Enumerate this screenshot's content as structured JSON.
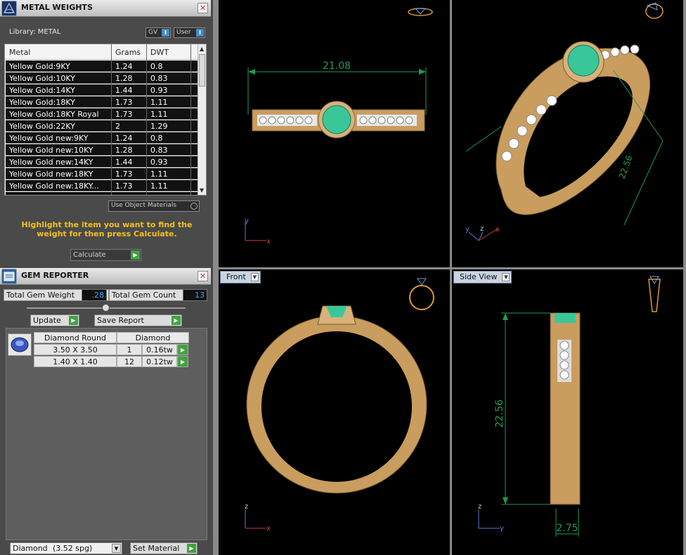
{
  "metal_panel": {
    "title": "METAL WEIGHTS",
    "library_label": "Library: METAL",
    "gv_label": "GV",
    "user_label": "User",
    "columns": [
      "Metal",
      "Grams",
      "DWT"
    ],
    "rows": [
      {
        "metal": "Yellow Gold:9KY",
        "grams": "1.24",
        "dwt": "0.8"
      },
      {
        "metal": "Yellow Gold:10KY",
        "grams": "1.28",
        "dwt": "0.83"
      },
      {
        "metal": "Yellow Gold:14KY",
        "grams": "1.44",
        "dwt": "0.93"
      },
      {
        "metal": "Yellow Gold:18KY",
        "grams": "1.73",
        "dwt": "1.11"
      },
      {
        "metal": "Yellow Gold:18KY Royal",
        "grams": "1.73",
        "dwt": "1.11"
      },
      {
        "metal": "Yellow Gold:22KY",
        "grams": "2",
        "dwt": "1.29"
      },
      {
        "metal": "Yellow Gold new:9KY",
        "grams": "1.24",
        "dwt": "0.8"
      },
      {
        "metal": "Yellow Gold new:10KY",
        "grams": "1.28",
        "dwt": "0.83"
      },
      {
        "metal": "Yellow Gold new:14KY",
        "grams": "1.44",
        "dwt": "0.93"
      },
      {
        "metal": "Yellow Gold new:18KY",
        "grams": "1.73",
        "dwt": "1.11"
      },
      {
        "metal": "Yellow Gold new:18KY...",
        "grams": "1.73",
        "dwt": "1.11"
      }
    ],
    "use_object_materials_label": "Use Object Materials",
    "hint_text": "Highlight the item you want to find the weight for then press Calculate.",
    "calculate_label": "Calculate"
  },
  "gem_panel": {
    "title": "GEM REPORTER",
    "total_weight_label": "Total Gem Weight",
    "total_weight_value": ".28",
    "total_count_label": "Total Gem Count",
    "total_count_value": "13",
    "update_label": "Update",
    "save_report_label": "Save Report",
    "table_header": {
      "shape": "Diamond Round",
      "material": "Diamond"
    },
    "rows": [
      {
        "size": "3.50 X 3.50",
        "count": "1",
        "weight": "0.16tw"
      },
      {
        "size": "1.40 X 1.40",
        "count": "12",
        "weight": "0.12tw"
      }
    ]
  },
  "bottom": {
    "material_select_value": "Diamond",
    "material_select_spg": "(3.52 spg)",
    "set_material_label": "Set Material"
  },
  "viewports": {
    "top": {
      "dimension": "21.08",
      "axis_primary": "y",
      "axis_secondary": "x"
    },
    "perspective": {
      "dimension": "22.56",
      "axis_labels": [
        "y",
        "z",
        "x"
      ]
    },
    "front": {
      "label": "Front",
      "axis_primary": "z",
      "axis_secondary": "x"
    },
    "side": {
      "label": "Side View",
      "height_dim": "22.56",
      "width_dim": "2.75",
      "axis_primary": "z",
      "axis_secondary": "y"
    }
  },
  "colors": {
    "gold": "#d8b27a",
    "emerald": "#39c79a",
    "dimension": "#1f9a57",
    "hint": "#f3c21a"
  }
}
